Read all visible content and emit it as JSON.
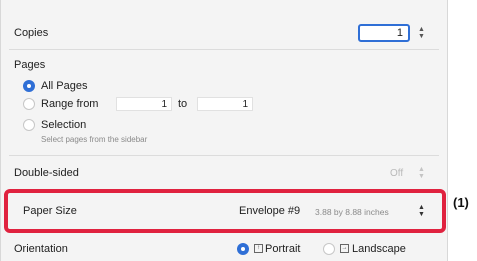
{
  "copies": {
    "label": "Copies",
    "value": "1"
  },
  "pages": {
    "label": "Pages",
    "all_pages": "All Pages",
    "range_from": "Range from",
    "range_start": "1",
    "to": "to",
    "range_end": "1",
    "selection": "Selection",
    "selection_hint": "Select pages from the sidebar"
  },
  "double_sided": {
    "label": "Double-sided",
    "value": "Off"
  },
  "paper_size": {
    "label": "Paper Size",
    "value": "Envelope #9",
    "dimensions": "3.88 by 8.88 inches"
  },
  "orientation": {
    "label": "Orientation",
    "portrait": "Portrait",
    "landscape": "Landscape"
  },
  "callout": "(1)",
  "colors": {
    "accent": "#2f6fd6",
    "highlight": "#e0223f"
  }
}
